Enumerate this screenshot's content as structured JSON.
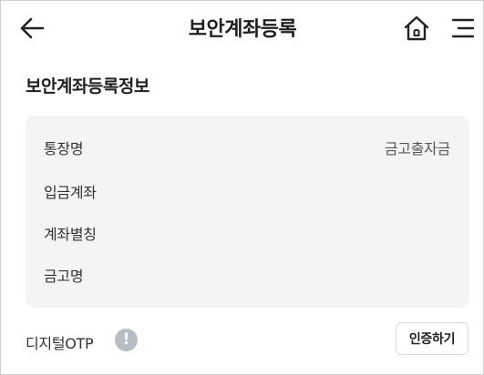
{
  "header": {
    "title": "보안계좌등록",
    "icons": {
      "back": "arrow-left-icon",
      "home": "home-icon",
      "menu": "hamburger-menu-icon"
    }
  },
  "section": {
    "title": "보안계좌등록정보"
  },
  "info": {
    "rows": [
      {
        "label": "통장명",
        "value": "금고출자금"
      },
      {
        "label": "입금계좌",
        "value": ""
      },
      {
        "label": "계좌별칭",
        "value": ""
      },
      {
        "label": "금고명",
        "value": ""
      }
    ]
  },
  "otp": {
    "label": "디지털OTP",
    "info_icon": "!",
    "button_label": "인증하기"
  },
  "colors": {
    "card_background": "#f3f4f6",
    "info_icon": "#b9bcc2",
    "text": "#222222",
    "border": "#d9d9d9"
  }
}
